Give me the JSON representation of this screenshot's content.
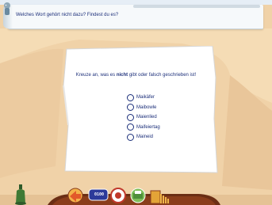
{
  "header": {
    "question": "Welches Wort gehört nicht dazu? Findest du es?"
  },
  "task": {
    "instruction_before": "Kreuze an, was es ",
    "instruction_bold": "nicht",
    "instruction_after": " gibt oder falsch geschrieben ist!"
  },
  "options": [
    {
      "label": "Maikäfer",
      "selected": false
    },
    {
      "label": "Maibowle",
      "selected": false
    },
    {
      "label": "Maienlied",
      "selected": false
    },
    {
      "label": "Maifeiertag",
      "selected": false
    },
    {
      "label": "Maineid",
      "selected": false
    }
  ],
  "toolbar": {
    "counter_label": "0100",
    "items": [
      {
        "name": "home-arrow-icon",
        "color": "#e2592a"
      },
      {
        "name": "counter-icon",
        "color": "#2c3b9a"
      },
      {
        "name": "help-icon",
        "color": "#c0392b"
      },
      {
        "name": "print-icon",
        "color": "#4f8f3a"
      },
      {
        "name": "folder-icon",
        "color": "#e3a437"
      }
    ]
  },
  "colors": {
    "background": "#f0d2a8",
    "text": "#1c2f7a",
    "paper": "#ffffff",
    "header": "#f6f9fb"
  }
}
